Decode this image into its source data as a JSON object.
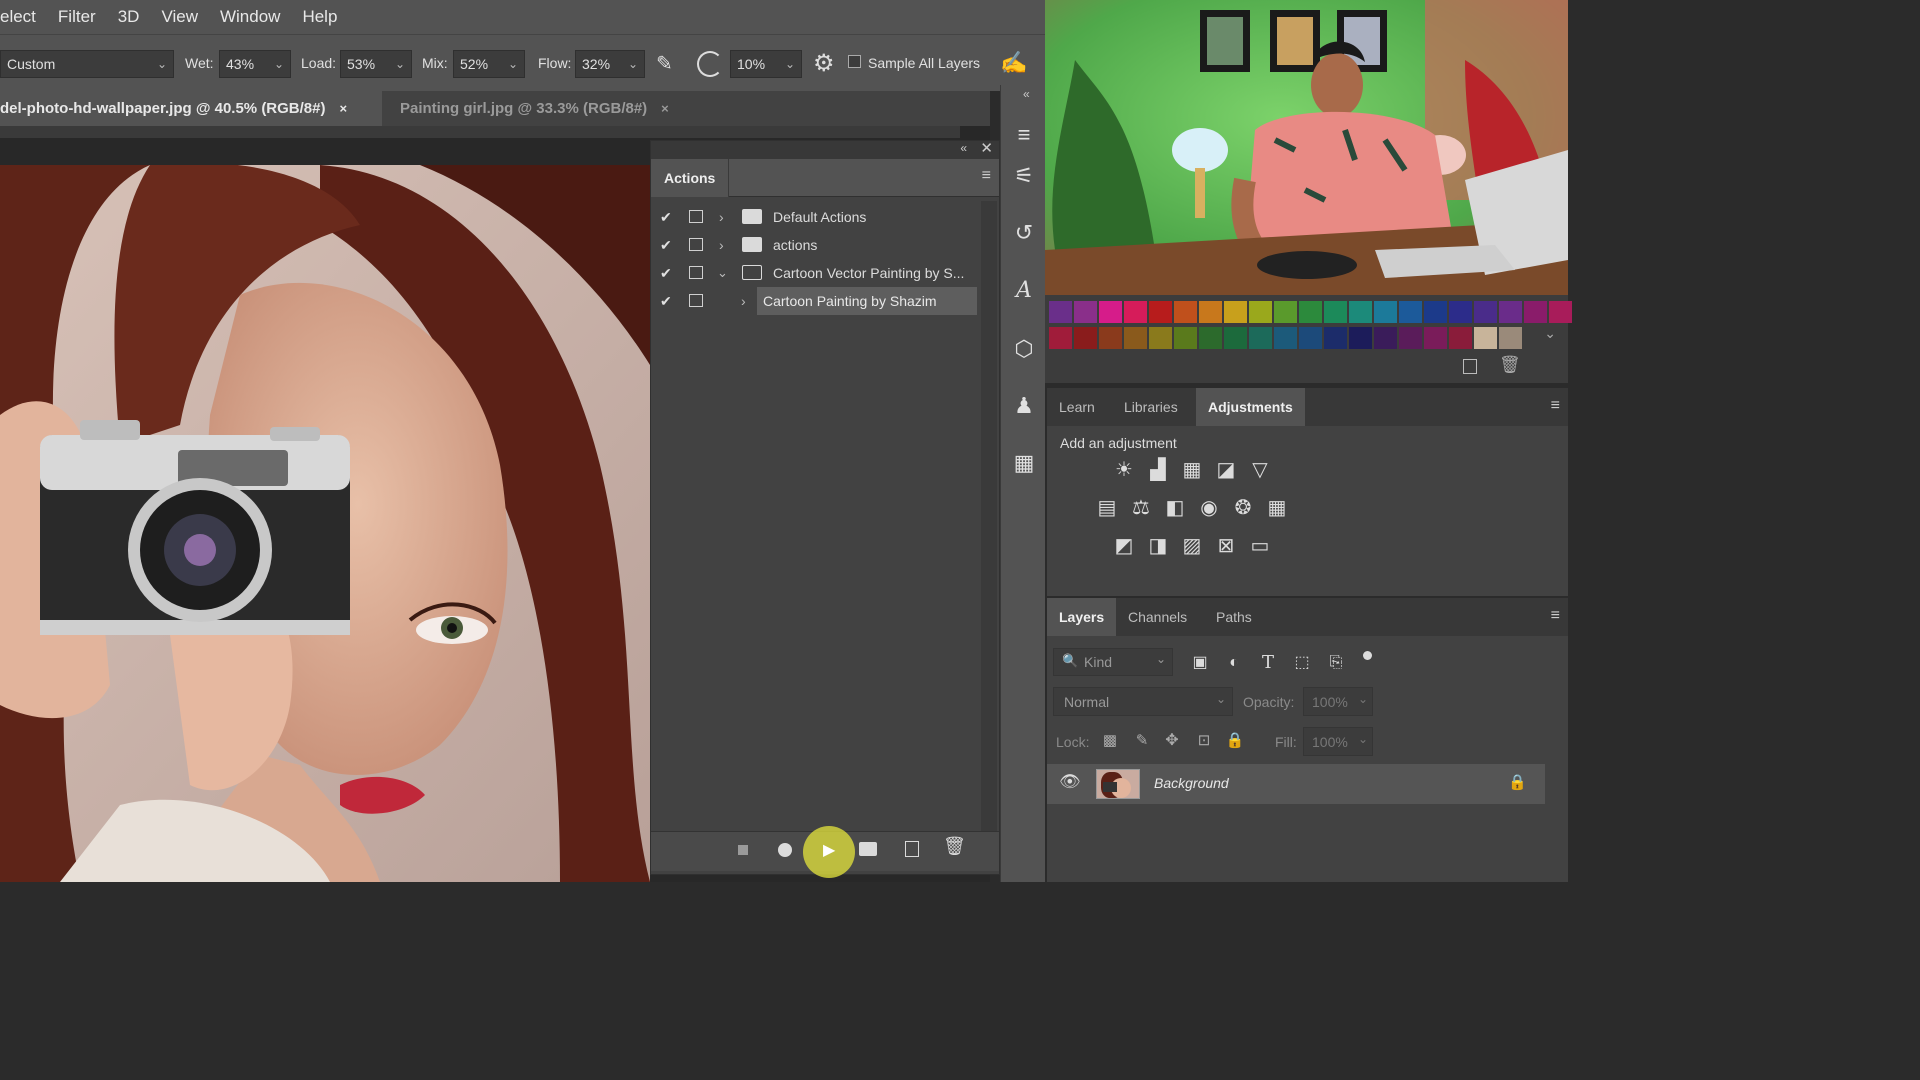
{
  "menu": [
    "elect",
    "Filter",
    "3D",
    "View",
    "Window",
    "Help"
  ],
  "options": {
    "preset": "Custom",
    "wet_label": "Wet:",
    "wet_value": "43%",
    "load_label": "Load:",
    "load_value": "53%",
    "mix_label": "Mix:",
    "mix_value": "52%",
    "flow_label": "Flow:",
    "flow_value": "32%",
    "angle_value": "10%",
    "sample_all_label": "Sample All Layers"
  },
  "tabs": [
    {
      "label": "del-photo-hd-wallpaper.jpg @ 40.5% (RGB/8#)",
      "close": "×"
    },
    {
      "label": "Painting girl.jpg @ 33.3% (RGB/8#)",
      "close": "×"
    }
  ],
  "actions_panel": {
    "title": "Actions",
    "rows": [
      {
        "label": "Default Actions"
      },
      {
        "label": "actions"
      },
      {
        "label": "Cartoon Vector Painting by S..."
      },
      {
        "label": "Cartoon Painting by Shazim"
      }
    ]
  },
  "adjustments": {
    "tabs": [
      "Learn",
      "Libraries",
      "Adjustments"
    ],
    "prompt": "Add an adjustment"
  },
  "layers": {
    "tabs": [
      "Layers",
      "Channels",
      "Paths"
    ],
    "filter_placeholder": "Kind",
    "blend_mode": "Normal",
    "opacity_label": "Opacity:",
    "opacity_value": "100%",
    "lock_label": "Lock:",
    "fill_label": "Fill:",
    "fill_value": "100%",
    "layer_name": "Background"
  },
  "colors": {
    "swatch_row1": [
      "#6a2f8a",
      "#8a2f8a",
      "#d61c8a",
      "#d61c5a",
      "#b71c1c",
      "#c0501c",
      "#c8781c",
      "#c8a01c",
      "#9aa81c",
      "#5a9a2c",
      "#2c8a3c",
      "#1c8a5a",
      "#1c8a7a",
      "#1c7a9a",
      "#1c5a9a",
      "#1c3a8a",
      "#2c2c8a",
      "#4a2c8a",
      "#6a2c8a",
      "#8a1c6a",
      "#a81c5a"
    ],
    "swatch_row2": [
      "#a01c3a",
      "#8a1c1c",
      "#8a3a1c",
      "#8a5a1c",
      "#8a7a1c",
      "#5a7a1c",
      "#2c6a2c",
      "#1c6a3c",
      "#1c6a5a",
      "#1c5a7a",
      "#1c4a7a",
      "#1c2c6a",
      "#1c1c5a",
      "#3a1c5a",
      "#5a1c5a",
      "#7a1c5a",
      "#8a1c3a",
      "#c8b49a",
      "#9a8a7a"
    ]
  }
}
